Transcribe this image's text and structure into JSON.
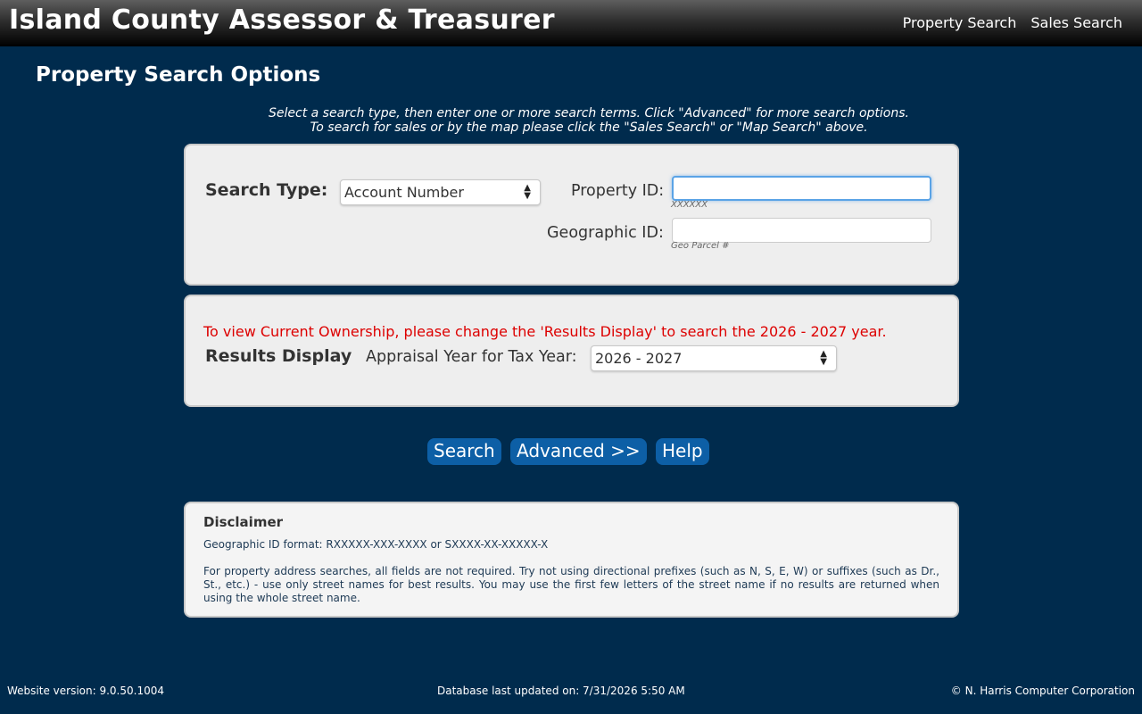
{
  "header": {
    "title": "Island County Assessor & Treasurer",
    "nav": [
      "Property Search",
      "Sales Search"
    ]
  },
  "page": {
    "title": "Property Search Options",
    "intro_line1": "Select a search type, then enter one or more search terms. Click \"Advanced\" for more search options.",
    "intro_line2": "To search for sales or by the map please click the \"Sales Search\" or \"Map Search\" above."
  },
  "search_panel": {
    "search_type_label": "Search Type:",
    "search_type_value": "Account Number",
    "property_id_label": "Property ID:",
    "property_id_value": "",
    "property_id_hint": "XXXXXX",
    "geographic_id_label": "Geographic ID:",
    "geographic_id_value": "",
    "geographic_id_hint": "Geo Parcel #"
  },
  "results_panel": {
    "warning": "To view Current Ownership, please change the 'Results Display' to search the 2026 - 2027 year.",
    "results_display_label": "Results Display",
    "appraisal_year_label": "Appraisal Year for Tax Year:",
    "appraisal_year_value": "2026 - 2027"
  },
  "buttons": {
    "search": "Search",
    "advanced": "Advanced >>",
    "help": "Help"
  },
  "disclaimer": {
    "title": "Disclaimer",
    "paragraph1": "Geographic ID format: RXXXXX-XXX-XXXX or SXXXX-XX-XXXXX-X",
    "paragraph2": "For property address searches, all fields are not required. Try not using directional prefixes (such as N, S, E, W) or suffixes (such as Dr., St., etc.) - use only street names for best results. You may use the first few letters of the street name if no results are returned when using the whole street name."
  },
  "footer": {
    "version": "Website version: 9.0.50.1004",
    "db_updated": "Database last updated on: 7/31/2026 5:50 AM",
    "copyright": "© N. Harris Computer Corporation"
  },
  "colors": {
    "background": "#002b4d",
    "button": "#0d5fa6",
    "warning": "#dd0000",
    "panel": "#eeeeee"
  }
}
